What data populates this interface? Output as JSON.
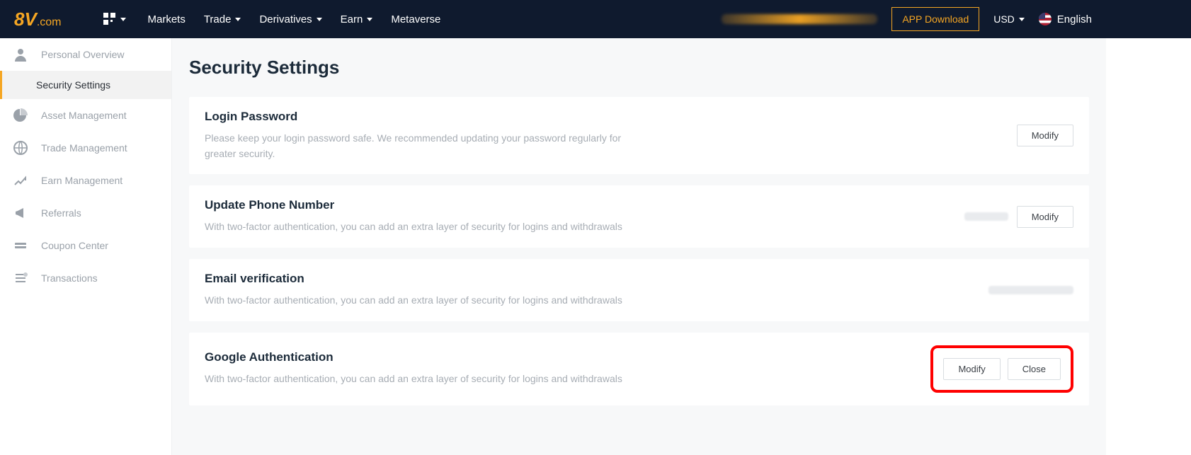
{
  "header": {
    "logo": {
      "main": "8V",
      "suffix": ".com"
    },
    "nav": [
      "Markets",
      "Trade",
      "Derivatives",
      "Earn",
      "Metaverse"
    ],
    "nav_has_caret": [
      false,
      true,
      true,
      true,
      false
    ],
    "app_download": "APP Download",
    "currency": "USD",
    "language": "English"
  },
  "sidebar": {
    "items": [
      {
        "label": "Personal Overview",
        "icon": "user-icon"
      },
      {
        "label": "Security Settings",
        "icon": "",
        "active": true
      },
      {
        "label": "Asset Management",
        "icon": "pie-icon"
      },
      {
        "label": "Trade Management",
        "icon": "globe-icon"
      },
      {
        "label": "Earn Management",
        "icon": "chart-icon"
      },
      {
        "label": "Referrals",
        "icon": "megaphone-icon"
      },
      {
        "label": "Coupon Center",
        "icon": "coupon-icon"
      },
      {
        "label": "Transactions",
        "icon": "list-icon"
      }
    ]
  },
  "page": {
    "title": "Security Settings",
    "cards": [
      {
        "title": "Login Password",
        "desc": "Please keep your login password safe. We recommended updating your password regularly for greater security.",
        "buttons": [
          "Modify"
        ],
        "value": null
      },
      {
        "title": "Update Phone Number",
        "desc": "With two-factor authentication, you can add an extra layer of security for logins and withdrawals",
        "buttons": [
          "Modify"
        ],
        "value": "redacted-short"
      },
      {
        "title": "Email verification",
        "desc": "With two-factor authentication, you can add an extra layer of security for logins and withdrawals",
        "buttons": [],
        "value": "redacted-long"
      },
      {
        "title": "Google Authentication",
        "desc": "With two-factor authentication, you can add an extra layer of security for logins and withdrawals",
        "buttons": [
          "Modify",
          "Close"
        ],
        "value": null,
        "highlight": true
      }
    ]
  }
}
